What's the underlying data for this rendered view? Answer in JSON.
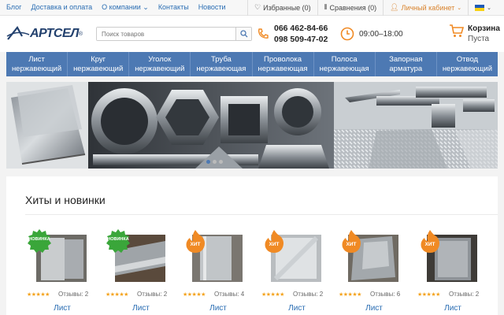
{
  "topbar": {
    "links": [
      "Блог",
      "Доставка и оплата",
      "О компании",
      "Контакты",
      "Новости"
    ],
    "favorites": "Избранные (0)",
    "compare": "Сравнения (0)",
    "account": "Личный кабинет"
  },
  "header": {
    "logo": "АРТСЕЛ",
    "logo_mark": "®",
    "search_placeholder": "Поиск товаров",
    "phone1": "066 462-84-66",
    "phone2": "098 509-47-02",
    "hours": "09:00–18:00",
    "cart_title": "Корзина",
    "cart_status": "Пуста"
  },
  "nav": [
    {
      "line1": "Лист",
      "line2": "нержавеющий"
    },
    {
      "line1": "Круг",
      "line2": "нержавеющий"
    },
    {
      "line1": "Уголок",
      "line2": "нержавеющий"
    },
    {
      "line1": "Труба",
      "line2": "нержавеющая"
    },
    {
      "line1": "Проволока",
      "line2": "нержавеющая"
    },
    {
      "line1": "Полоса",
      "line2": "нержавеющая"
    },
    {
      "line1": "Запорная",
      "line2": "арматура"
    },
    {
      "line1": "Отвод",
      "line2": "нержавеющий"
    }
  ],
  "section_title": "Хиты и новинки",
  "products": [
    {
      "badge": "НОВИНКА",
      "badge_type": "new",
      "reviews": "Отзывы: 2",
      "name": "Лист"
    },
    {
      "badge": "НОВИНКА",
      "badge_type": "new",
      "reviews": "Отзывы: 2",
      "name": "Лист"
    },
    {
      "badge": "ХИТ",
      "badge_type": "hit",
      "reviews": "Отзывы: 4",
      "name": "Лист"
    },
    {
      "badge": "ХИТ",
      "badge_type": "hit",
      "reviews": "Отзывы: 2",
      "name": "Лист"
    },
    {
      "badge": "ХИТ",
      "badge_type": "hit",
      "reviews": "Отзывы: 6",
      "name": "Лист"
    },
    {
      "badge": "ХИТ",
      "badge_type": "hit",
      "reviews": "Отзывы: 2",
      "name": "Лист"
    }
  ],
  "rating_stars": "★★★★★",
  "colors": {
    "accent": "#4d79b3",
    "link": "#2a6db3",
    "orange": "#f08a24",
    "badge_new": "#3aa63a",
    "star": "#f4a21b"
  }
}
